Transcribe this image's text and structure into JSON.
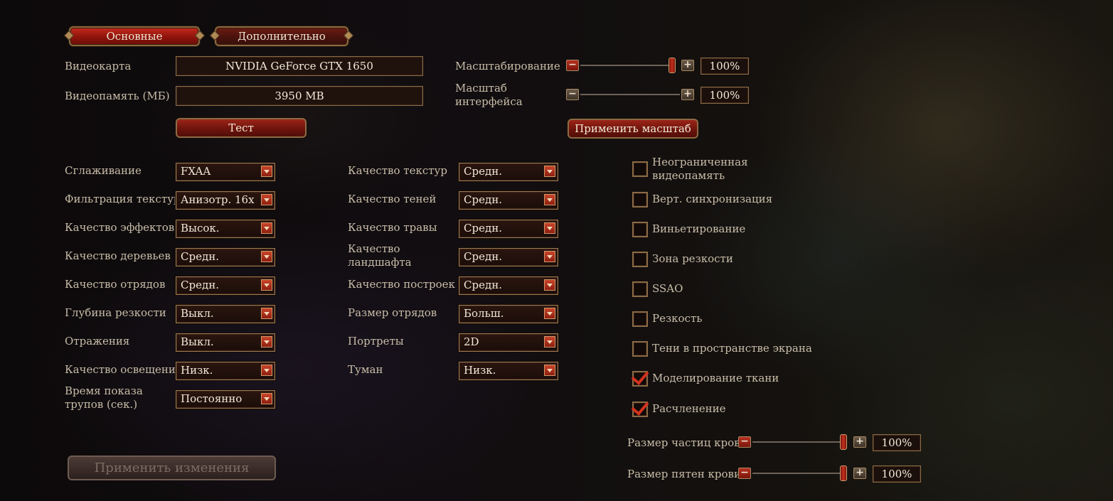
{
  "tabs": [
    {
      "label": "Основные",
      "active": true
    },
    {
      "label": "Дополнительно",
      "active": false
    }
  ],
  "hardware": {
    "gpu_label": "Видеокарта",
    "gpu_value": "NVIDIA GeForce GTX 1650",
    "vram_label": "Видеопамять (МБ)",
    "vram_value": "3950 MB",
    "test_button": "Тест"
  },
  "scaling": {
    "ui_scale_label": "Масштабирование",
    "ui_scale_value": "100%",
    "ui_scale_level": 1.0,
    "interface_scale_label_1": "Масштаб",
    "interface_scale_label_2": "интерфейса",
    "interface_scale_value": "100%",
    "interface_scale_level": 1.0,
    "apply_scale_button": "Применить масштаб"
  },
  "left_settings": [
    {
      "label": "Сглаживание",
      "value": "FXAA"
    },
    {
      "label": "Фильтрация текстур",
      "value": "Анизотр. 16x"
    },
    {
      "label": "Качество эффектов",
      "value": "Высок."
    },
    {
      "label": "Качество деревьев",
      "value": "Средн."
    },
    {
      "label": "Качество отрядов",
      "value": "Средн."
    },
    {
      "label": "Глубина резкости",
      "value": "Выкл."
    },
    {
      "label": "Отражения",
      "value": "Выкл."
    },
    {
      "label": "Качество освещения",
      "value": "Низк."
    },
    {
      "label": "Время показа",
      "label2": "трупов (сек.)",
      "value": "Постоянно"
    }
  ],
  "mid_settings": [
    {
      "label": "Качество текстур",
      "value": "Средн."
    },
    {
      "label": "Качество теней",
      "value": "Средн."
    },
    {
      "label": "Качество травы",
      "value": "Средн."
    },
    {
      "label": "Качество",
      "label2": "ландшафта",
      "value": "Средн."
    },
    {
      "label": "Качество построек",
      "value": "Средн."
    },
    {
      "label": "Размер отрядов",
      "value": "Больш."
    },
    {
      "label": "Портреты",
      "value": "2D"
    },
    {
      "label": "Туман",
      "value": "Низк."
    }
  ],
  "checkboxes": [
    {
      "label": "Неограниченная",
      "label2": "видеопамять",
      "checked": false
    },
    {
      "label": "Верт. синхронизация",
      "checked": false
    },
    {
      "label": "Виньетирование",
      "checked": false
    },
    {
      "label": "Зона резкости",
      "checked": false
    },
    {
      "label": "SSAO",
      "checked": false
    },
    {
      "label": "Резкость",
      "checked": false
    },
    {
      "label": "Тени в пространстве экрана",
      "checked": false
    },
    {
      "label": "Моделирование ткани",
      "checked": true
    },
    {
      "label": "Расчленение",
      "checked": true
    }
  ],
  "blood": {
    "particles_label": "Размер частиц крови",
    "particles_value": "100%",
    "particles_level": 1.0,
    "stains_label": "Размер пятен крови",
    "stains_value": "100%",
    "stains_level": 1.0
  },
  "apply_changes_button": "Применить изменения",
  "icons": {
    "minus": "−",
    "plus": "+"
  }
}
